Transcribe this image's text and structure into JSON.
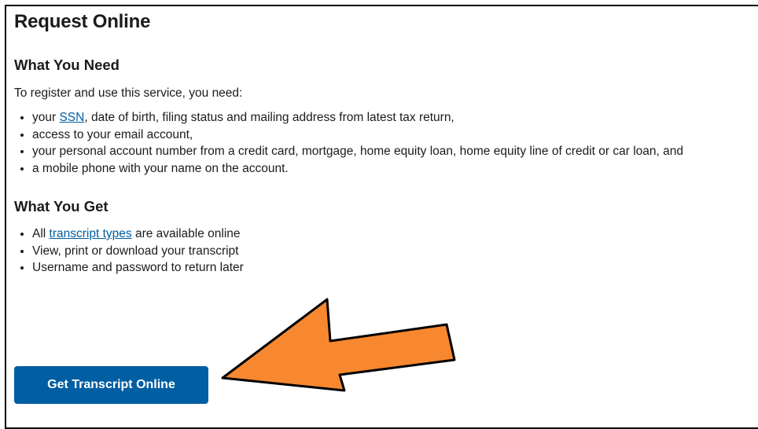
{
  "page_title": "Request Online",
  "need_section": {
    "heading": "What You Need",
    "intro": "To register and use this service, you need:",
    "items": [
      {
        "prefix": "your ",
        "link": "SSN",
        "suffix": ", date of birth, filing status and mailing address from latest tax return,"
      },
      {
        "text": "access to your email account,"
      },
      {
        "text": "your personal account number from a credit card, mortgage, home equity loan, home equity line of credit or car loan, and"
      },
      {
        "text": "a mobile phone with your name on the account."
      }
    ]
  },
  "get_section": {
    "heading": "What You Get",
    "items": [
      {
        "prefix": "All ",
        "link": "transcript types",
        "suffix": " are available online"
      },
      {
        "text": "View, print or download your transcript"
      },
      {
        "text": "Username and password to return later"
      }
    ]
  },
  "cta_button": {
    "label": "Get Transcript Online"
  },
  "annotation_arrow": {
    "color": "#f7882f",
    "outline": "#000000",
    "icon": "arrow-left-icon"
  },
  "colors": {
    "link": "#005ea2",
    "button_bg": "#005ea2",
    "button_text": "#ffffff"
  }
}
